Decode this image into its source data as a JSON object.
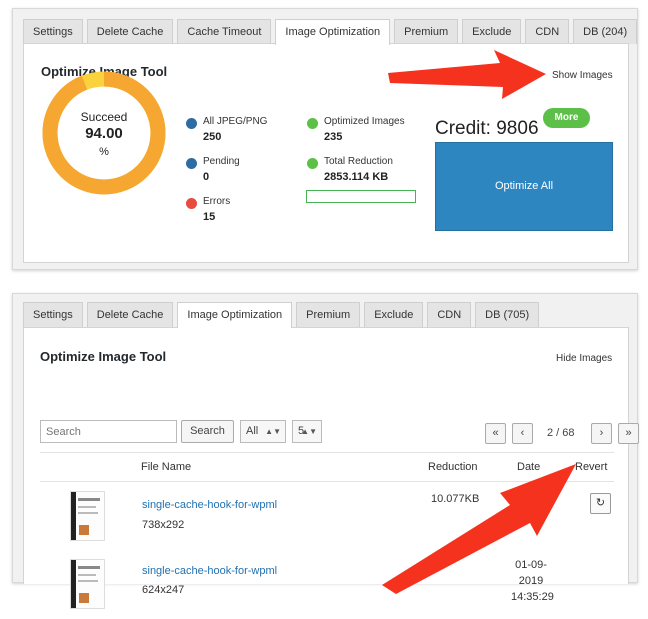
{
  "top": {
    "tabs": [
      "Settings",
      "Delete Cache",
      "Cache Timeout",
      "Image Optimization",
      "Premium",
      "Exclude",
      "CDN",
      "DB (204)"
    ],
    "title": "Optimize Image Tool",
    "show_images": "Show Images",
    "donut": {
      "label": "Succeed",
      "value": "94.00",
      "unit": "%",
      "percent": 94.0,
      "ring_color": "#f5a731",
      "rest_color": "#f9d23c"
    },
    "stats": {
      "all": {
        "label": "All JPEG/PNG",
        "value": "250",
        "color": "#2e6da4"
      },
      "pending": {
        "label": "Pending",
        "value": "0",
        "color": "#2e6da4"
      },
      "errors": {
        "label": "Errors",
        "value": "15",
        "color": "#e74c3c"
      },
      "optimized": {
        "label": "Optimized Images",
        "value": "235",
        "color": "#5cc048"
      },
      "reduction": {
        "label": "Total Reduction",
        "value": "2853.114 KB",
        "color": "#5cc048"
      }
    },
    "progress_fraction": 0,
    "credit": "Credit: 9806",
    "more_label": "More",
    "optimize_label": "Optimize All"
  },
  "bottom": {
    "tabs": [
      "Settings",
      "Delete Cache",
      "Image Optimization",
      "Premium",
      "Exclude",
      "CDN",
      "DB (705)"
    ],
    "title": "Optimize Image Tool",
    "hide_images": "Hide Images",
    "search_placeholder": "Search",
    "search_button": "Search",
    "filter_select": "All",
    "per_page_select": "5",
    "pager": {
      "first": "«",
      "prev": "‹",
      "text": "2 / 68",
      "next": "›",
      "last": "»"
    },
    "columns": {
      "file": "File Name",
      "reduction": "Reduction",
      "date": "Date",
      "revert": "Revert"
    },
    "rows": [
      {
        "name": "single-cache-hook-for-wpml",
        "size": "738x292",
        "reduction": "10.077KB",
        "date": [
          "01-09-",
          "",
          ""
        ],
        "revert": "↻"
      },
      {
        "name": "single-cache-hook-for-wpml",
        "size": "624x247",
        "reduction": "4.0",
        "date": [
          "01-09-",
          "2019",
          "14:35:29"
        ]
      }
    ]
  },
  "colors": {
    "arrow": "#f5321e",
    "link": "#2271b1",
    "primary": "#2e86c1",
    "success": "#5cc048"
  }
}
